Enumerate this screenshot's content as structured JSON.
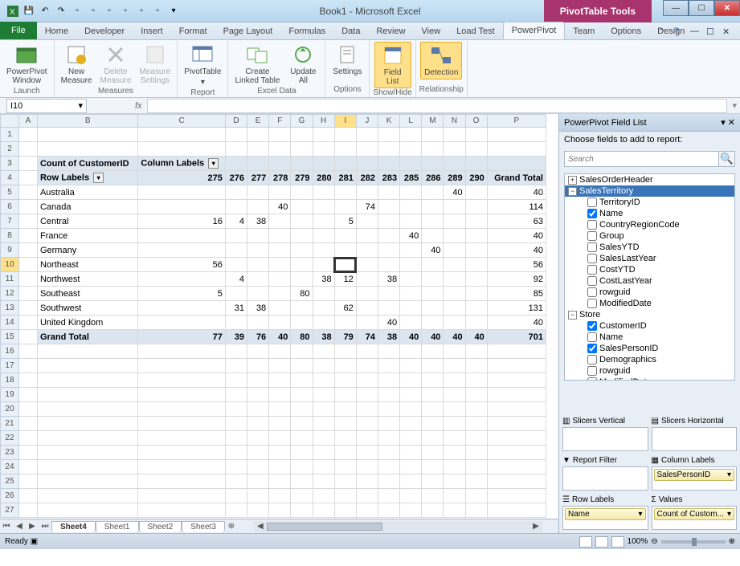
{
  "title": "Book1 - Microsoft Excel",
  "pivot_tools_label": "PivotTable Tools",
  "tabs": {
    "file": "File",
    "list": [
      "Home",
      "Developer",
      "Insert",
      "Format",
      "Page Layout",
      "Formulas",
      "Data",
      "Review",
      "View",
      "Load Test",
      "PowerPivot",
      "Team",
      "Options",
      "Design"
    ],
    "active": "PowerPivot"
  },
  "ribbon": {
    "launch": {
      "powerpivot_window": "PowerPivot\nWindow",
      "label": "Launch"
    },
    "measures": {
      "new": "New\nMeasure",
      "delete": "Delete\nMeasure",
      "settings": "Measure\nSettings",
      "label": "Measures"
    },
    "report": {
      "pivottable": "PivotTable",
      "label": "Report"
    },
    "exceldata": {
      "create": "Create\nLinked Table",
      "update": "Update\nAll",
      "label": "Excel Data"
    },
    "options": {
      "settings": "Settings",
      "label": "Options"
    },
    "showhide": {
      "fieldlist": "Field\nList",
      "label": "Show/Hide"
    },
    "relationship": {
      "detection": "Detection",
      "label": "Relationship"
    }
  },
  "namebox": "I10",
  "fx_label": "fx",
  "columns": [
    "A",
    "B",
    "C",
    "D",
    "E",
    "F",
    "G",
    "H",
    "I",
    "J",
    "K",
    "L",
    "M",
    "N",
    "O",
    "P"
  ],
  "pivot": {
    "count_label": "Count of CustomerID",
    "column_labels": "Column Labels",
    "row_labels": "Row Labels",
    "col_values": [
      "275",
      "276",
      "277",
      "278",
      "279",
      "280",
      "281",
      "282",
      "283",
      "285",
      "286",
      "289",
      "290"
    ],
    "grand_total_label": "Grand Total",
    "rows": [
      {
        "label": "Australia",
        "vals": [
          "",
          "",
          "",
          "",
          "",
          "",
          "",
          "",
          "",
          "",
          "",
          "40",
          ""
        ],
        "total": "40"
      },
      {
        "label": "Canada",
        "vals": [
          "",
          "",
          "",
          "40",
          "",
          "",
          "",
          "74",
          "",
          "",
          "",
          "",
          ""
        ],
        "total": "114"
      },
      {
        "label": "Central",
        "vals": [
          "16",
          "4",
          "38",
          "",
          "",
          "",
          "5",
          "",
          "",
          "",
          "",
          "",
          ""
        ],
        "total": "63"
      },
      {
        "label": "France",
        "vals": [
          "",
          "",
          "",
          "",
          "",
          "",
          "",
          "",
          "",
          "40",
          "",
          "",
          ""
        ],
        "total": "40"
      },
      {
        "label": "Germany",
        "vals": [
          "",
          "",
          "",
          "",
          "",
          "",
          "",
          "",
          "",
          "",
          "40",
          "",
          ""
        ],
        "total": "40"
      },
      {
        "label": "Northeast",
        "vals": [
          "56",
          "",
          "",
          "",
          "",
          "",
          "",
          "",
          "",
          "",
          "",
          "",
          ""
        ],
        "total": "56"
      },
      {
        "label": "Northwest",
        "vals": [
          "",
          "4",
          "",
          "",
          "",
          "38",
          "12",
          "",
          "38",
          "",
          "",
          "",
          ""
        ],
        "total": "92"
      },
      {
        "label": "Southeast",
        "vals": [
          "5",
          "",
          "",
          "",
          "80",
          "",
          "",
          "",
          "",
          "",
          "",
          "",
          ""
        ],
        "total": "85"
      },
      {
        "label": "Southwest",
        "vals": [
          "",
          "31",
          "38",
          "",
          "",
          "",
          "62",
          "",
          "",
          "",
          "",
          "",
          ""
        ],
        "total": "131"
      },
      {
        "label": "United Kingdom",
        "vals": [
          "",
          "",
          "",
          "",
          "",
          "",
          "",
          "",
          "40",
          "",
          "",
          "",
          ""
        ],
        "total": "40"
      }
    ],
    "grand_row": {
      "label": "Grand Total",
      "vals": [
        "77",
        "39",
        "76",
        "40",
        "80",
        "38",
        "79",
        "74",
        "38",
        "40",
        "40",
        "40",
        "40"
      ],
      "total": "701"
    }
  },
  "fieldlist": {
    "title": "PowerPivot Field List",
    "choose": "Choose fields to add to report:",
    "search_placeholder": "Search",
    "tables": {
      "salesorderheader": "SalesOrderHeader",
      "salesterritory": "SalesTerritory",
      "salesterritory_fields": [
        {
          "name": "TerritoryID",
          "checked": false
        },
        {
          "name": "Name",
          "checked": true
        },
        {
          "name": "CountryRegionCode",
          "checked": false
        },
        {
          "name": "Group",
          "checked": false
        },
        {
          "name": "SalesYTD",
          "checked": false
        },
        {
          "name": "SalesLastYear",
          "checked": false
        },
        {
          "name": "CostYTD",
          "checked": false
        },
        {
          "name": "CostLastYear",
          "checked": false
        },
        {
          "name": "rowguid",
          "checked": false
        },
        {
          "name": "ModifiedDate",
          "checked": false
        }
      ],
      "store": "Store",
      "store_fields": [
        {
          "name": "CustomerID",
          "checked": true
        },
        {
          "name": "Name",
          "checked": false
        },
        {
          "name": "SalesPersonID",
          "checked": true
        },
        {
          "name": "Demographics",
          "checked": false
        },
        {
          "name": "rowguid",
          "checked": false
        },
        {
          "name": "ModifiedDate",
          "checked": false
        }
      ]
    },
    "areas": {
      "slicers_v": "Slicers Vertical",
      "slicers_h": "Slicers Horizontal",
      "report_filter": "Report Filter",
      "column_labels": "Column Labels",
      "row_labels": "Row Labels",
      "values": "Values",
      "col_chip": "SalesPersonID",
      "row_chip": "Name",
      "val_chip": "Count of Custom..."
    }
  },
  "sheets": {
    "active": "Sheet4",
    "others": [
      "Sheet1",
      "Sheet2",
      "Sheet3"
    ]
  },
  "status": {
    "ready": "Ready",
    "zoom": "100%"
  }
}
